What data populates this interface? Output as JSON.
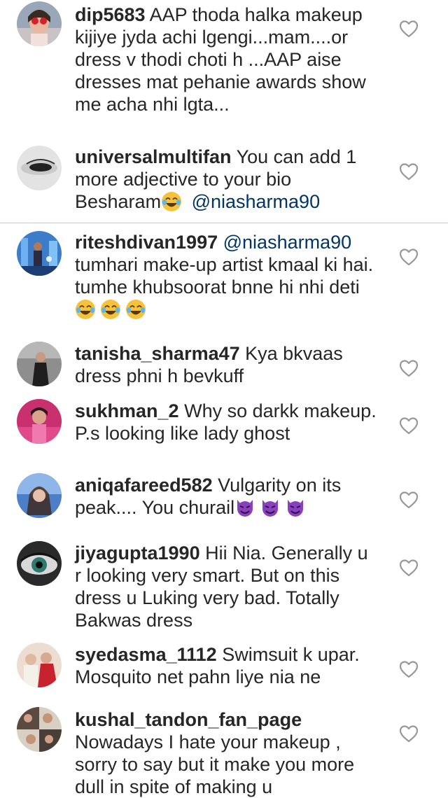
{
  "comments": [
    {
      "username": "dip5683",
      "text": "AAP thoda halka makeup kijiye jyda achi lgengi...mam....or dress v thodi choti h ...AAP aise dresses mat pehanie awards show me acha nhi lgta...",
      "avatar": "girl-red-heart-glasses-avatar"
    },
    {
      "username": "universalmultifan",
      "text": "You can add 1 more adjective to your bio Besharam",
      "emoji": "joy-emoji",
      "mention": "@niasharma90",
      "avatar": "eye-closeup-avatar"
    },
    {
      "username": "riteshdivan1997",
      "mention": "@niasharma90",
      "text": "tumhari  make-up artist kmaal ki hai. tumhe  khubsoorat  bnne hi nhi deti",
      "emoji": "joy-emoji x3",
      "avatar": "man-blue-city-avatar"
    },
    {
      "username": "tanisha_sharma47",
      "text": "Kya bkvaas dress phni h bevkuff",
      "avatar": "woman-dark-outfit-avatar"
    },
    {
      "username": "sukhman_2",
      "text": "Why so darkk makeup. P.s looking like  lady ghost",
      "avatar": "woman-pink-avatar"
    },
    {
      "username": "aniqafareed582",
      "text": "Vulgarity on its peak.... You churail",
      "emoji": "smiling-imp-emoji x3",
      "avatar": "woman-blue-avatar"
    },
    {
      "username": "jiyagupta1990",
      "text": "Hii Nia. Generally u r looking very smart. But on this dress u Luking very bad. Totally Bakwas dress",
      "avatar": "green-eye-avatar"
    },
    {
      "username": "syedasma_1112",
      "text": "Swimsuit k upar. Mosquito net pahn liye nia ne",
      "avatar": "bride-red-avatar"
    },
    {
      "username": "kushal_tandon_fan_page",
      "text": "Nowadays I hate your makeup , sorry to say but it make you more dull in spite of making u",
      "avatar": "man-collage-avatar"
    }
  ],
  "colors": {
    "text": "#262626",
    "mention": "#003569",
    "heart_outline": "#999999",
    "divider": "#c8c8c8"
  }
}
